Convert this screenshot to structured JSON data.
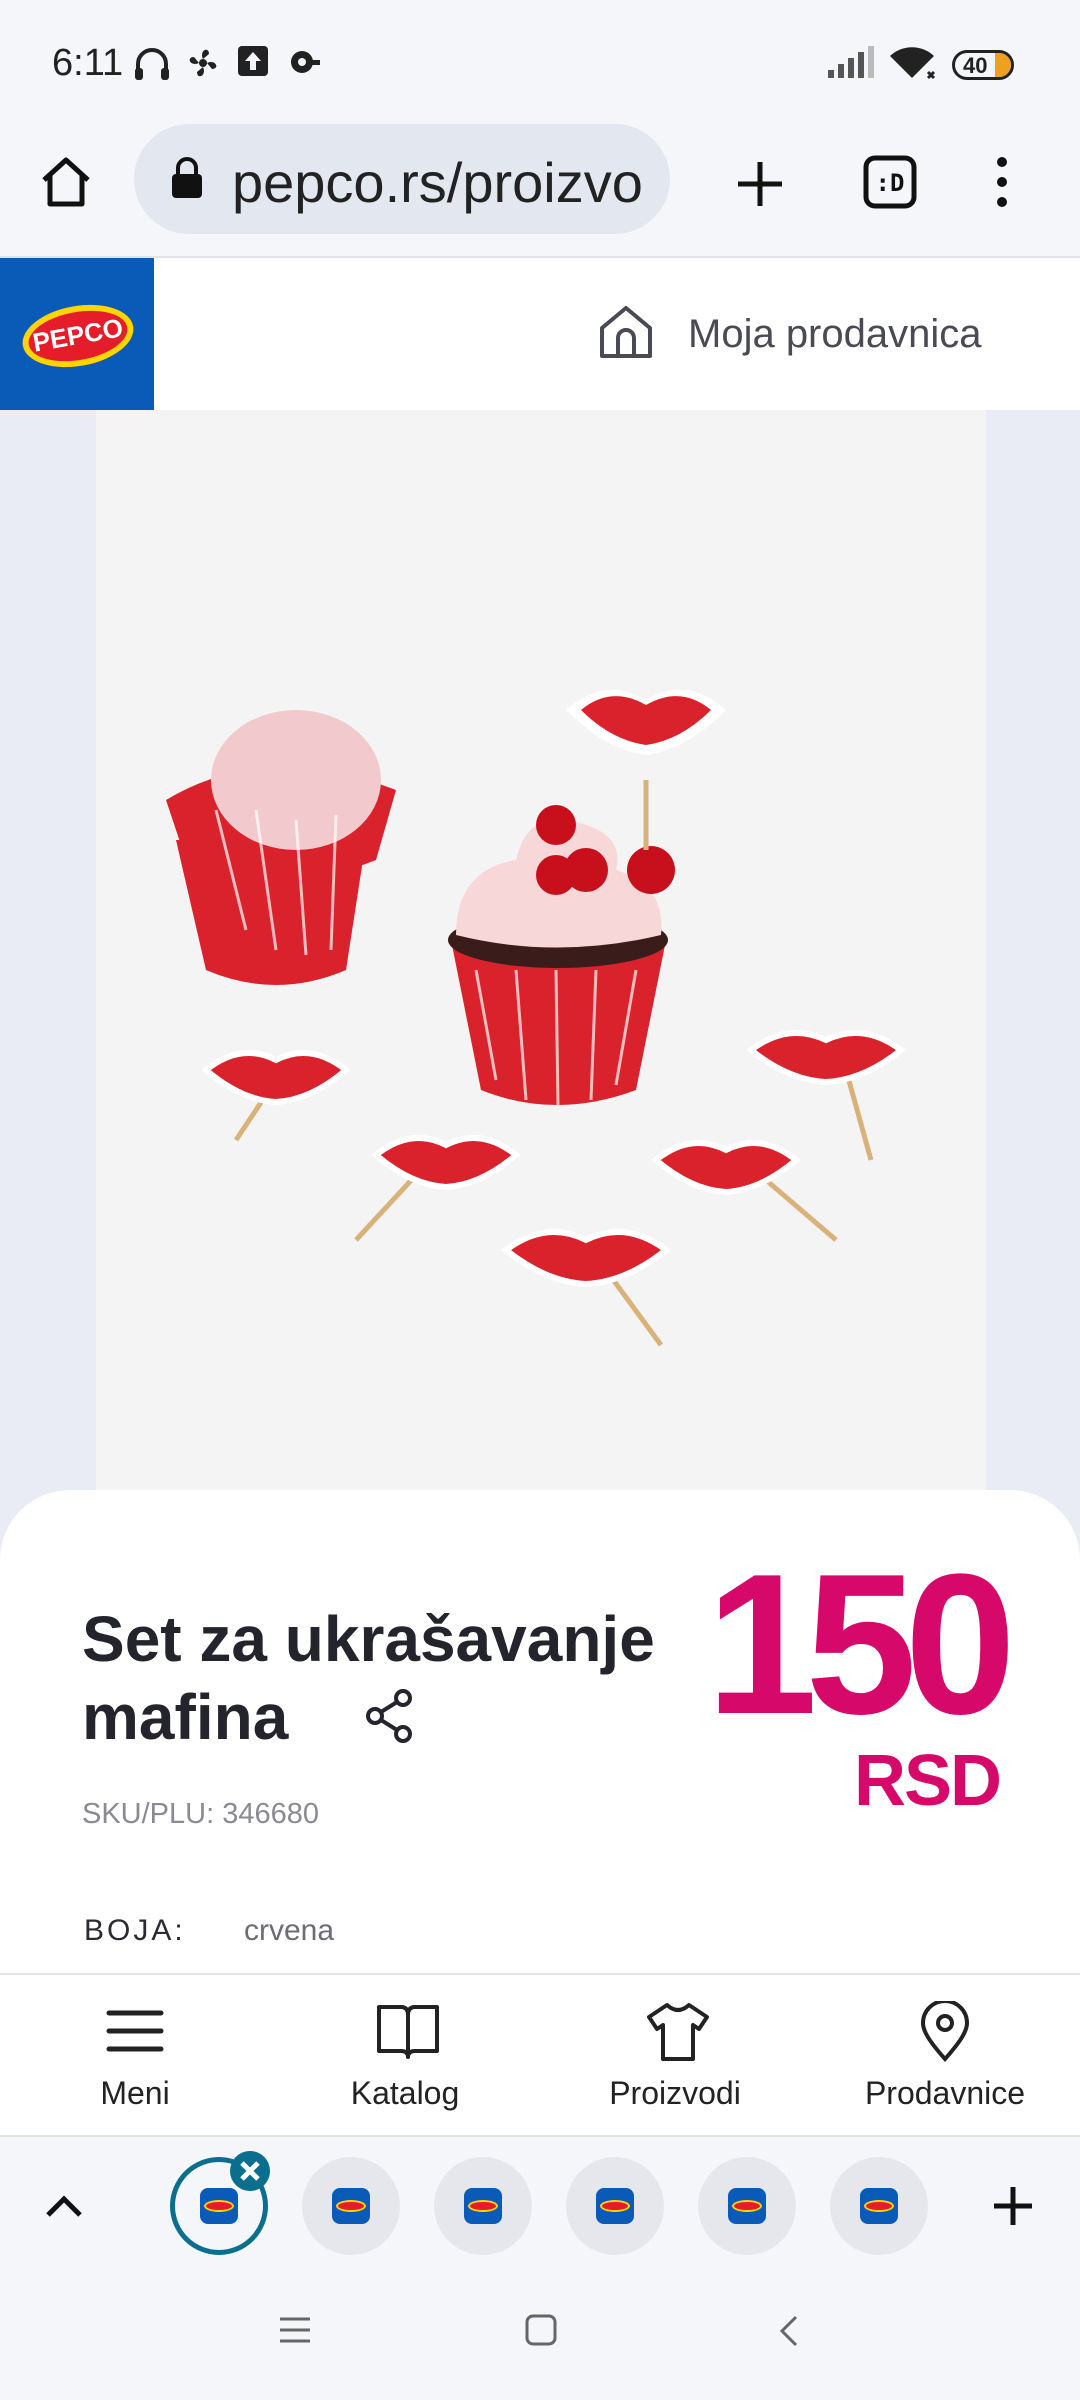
{
  "status_bar": {
    "time": "6:11",
    "battery": "40"
  },
  "browser": {
    "url": "pepco.rs/proizvo",
    "icons": [
      "home-icon",
      "lock-icon",
      "plus-icon",
      "tab-switcher-icon",
      "more-vert-icon"
    ]
  },
  "site_header": {
    "logo_text": "PEPCO",
    "store_label": "Moja prodavnica"
  },
  "product": {
    "title_line1": "Set za ukrašavanje",
    "title_line2": "mafina",
    "sku": "SKU/PLU: 346680",
    "price": "150",
    "currency": "RSD",
    "color_label": "BOJA:",
    "color_value": "crvena"
  },
  "site_nav": {
    "items": [
      {
        "label": "Meni",
        "icon": "menu-icon"
      },
      {
        "label": "Katalog",
        "icon": "book-icon"
      },
      {
        "label": "Proizvodi",
        "icon": "shirt-icon"
      },
      {
        "label": "Prodavnice",
        "icon": "location-pin-icon"
      }
    ]
  },
  "colors": {
    "accent_price": "#d6096b",
    "brand_blue": "#0a5bb8",
    "brand_red": "#e51c2a"
  }
}
